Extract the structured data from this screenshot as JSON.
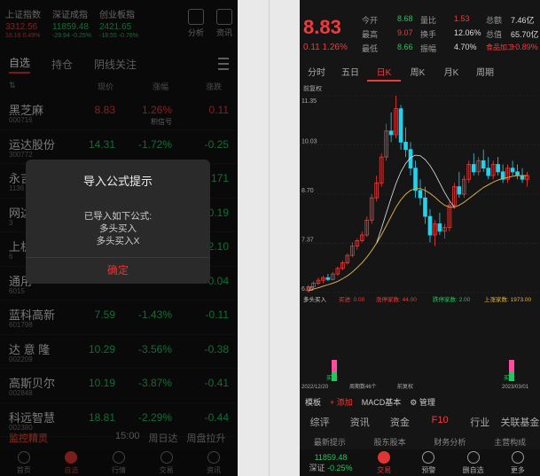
{
  "left": {
    "indices": [
      {
        "name": "上证指数",
        "value": "3312.56",
        "change": "16.16  0.49%",
        "color": "red"
      },
      {
        "name": "深证成指",
        "value": "11859.48",
        "change": "-29.94  -0.25%",
        "color": "green"
      },
      {
        "name": "创业板指",
        "value": "2421.65",
        "change": "-18.55  -0.76%",
        "color": "green"
      }
    ],
    "tools": {
      "analysis": "分析",
      "news": "资讯"
    },
    "tabs": [
      "自选",
      "持仓",
      "阴线关注"
    ],
    "columns": {
      "price": "现价",
      "pct": "涨幅",
      "chg": "涨跌"
    },
    "stocks": [
      {
        "name": "黑芝麻",
        "code": "000716",
        "price": "8.83",
        "pct": "1.26%",
        "chg": "0.11",
        "color": "red",
        "sub": "积信号"
      },
      {
        "name": "运达股份",
        "code": "300772",
        "price": "14.31",
        "pct": "-1.72%",
        "chg": "-0.25",
        "color": "green",
        "sub": ""
      },
      {
        "name": "永吉",
        "code": "1136",
        "price": "",
        "pct": "",
        "chg": "171",
        "color": "green",
        "sub": ""
      },
      {
        "name": "网达",
        "code": "3",
        "price": "",
        "pct": "",
        "chg": "0.19",
        "color": "green",
        "sub": ""
      },
      {
        "name": "上机",
        "code": "6",
        "price": "",
        "pct": "",
        "chg": "2.10",
        "color": "green",
        "sub": ""
      },
      {
        "name": "通用",
        "code": "6015",
        "price": "",
        "pct": "",
        "chg": "0.04",
        "color": "green",
        "sub": ""
      },
      {
        "name": "蓝科高新",
        "code": "601798",
        "price": "7.59",
        "pct": "-1.43%",
        "chg": "-0.11",
        "color": "green",
        "sub": ""
      },
      {
        "name": "达 意 隆",
        "code": "002209",
        "price": "10.29",
        "pct": "-3.56%",
        "chg": "-0.38",
        "color": "green",
        "sub": ""
      },
      {
        "name": "高斯贝尔",
        "code": "002848",
        "price": "10.19",
        "pct": "-3.87%",
        "chg": "-0.41",
        "color": "green",
        "sub": ""
      },
      {
        "name": "科远智慧",
        "code": "002380",
        "price": "18.81",
        "pct": "-2.29%",
        "chg": "-0.44",
        "color": "green",
        "sub": ""
      }
    ],
    "dialog": {
      "title": "导入公式提示",
      "lines": [
        "已导入如下公式:",
        "多头买入",
        "多头买入X"
      ],
      "confirm": "确定"
    },
    "bottom": {
      "brand": "监控精灵",
      "items": [
        "15:00",
        "周日达",
        "周盘拉升"
      ]
    },
    "nav": [
      "首页",
      "自选",
      "行情",
      "交易",
      "资讯"
    ]
  },
  "right": {
    "price": "8.83",
    "change": "0.11  1.26%",
    "quote": [
      {
        "a": "今开",
        "av": "8.68",
        "b": "量比",
        "bv": "1.53",
        "c": "总额",
        "cv": "7.46亿"
      },
      {
        "a": "最高",
        "av": "9.07",
        "b": "换手",
        "bv": "12.06%",
        "c": "总值",
        "cv": "65.70亿"
      },
      {
        "a": "最低",
        "av": "8.66",
        "b": "振幅",
        "bv": "4.70%",
        "c": "食品加工",
        "cv": "+0.89%"
      }
    ],
    "periods": [
      "分时",
      "五日",
      "日K",
      "周K",
      "月K",
      "周期"
    ],
    "chart_title": "前复权",
    "y_ticks": [
      "11.35",
      "10.03",
      "8.70",
      "7.37",
      "6.05"
    ],
    "indicator": {
      "name": "多头买入",
      "a": "买进: 0.00",
      "b": "涨停家数: 44.00",
      "c": "跌停家数: 2.00",
      "d": "上涨家数: 1973.00"
    },
    "dates": {
      "left": "2022/12/20",
      "mid": "周期数46个",
      "mid2": "前复权",
      "right": "2023/03/01"
    },
    "buy_label": "买进",
    "toolbar": {
      "template": "模板",
      "add": "添加",
      "macd": "MACD基本",
      "manage": "管理"
    },
    "ftabs": [
      "综评",
      "资讯",
      "资金",
      "F10",
      "行业",
      "关联基金"
    ],
    "subtabs": [
      "最新提示",
      "股东股本",
      "财务分析",
      "主营构成"
    ],
    "nav_index": {
      "value": "11859.48",
      "label": "深证",
      "pct": "-0.25%"
    },
    "nav": [
      "交易",
      "预警",
      "删自选",
      "更多"
    ]
  },
  "chart_data": {
    "type": "candlestick",
    "title": "",
    "ylim": [
      6.05,
      11.35
    ],
    "y_ticks": [
      11.35,
      10.03,
      8.7,
      7.37,
      6.05
    ],
    "x_range": [
      "2022/12/20",
      "2023/03/01"
    ],
    "candles": [
      [
        6.1,
        6.25,
        6.05,
        6.2
      ],
      [
        6.2,
        6.35,
        6.15,
        6.3
      ],
      [
        6.3,
        6.45,
        6.25,
        6.38
      ],
      [
        6.38,
        6.5,
        6.3,
        6.45
      ],
      [
        6.45,
        6.55,
        6.35,
        6.4
      ],
      [
        6.4,
        6.6,
        6.38,
        6.55
      ],
      [
        6.55,
        6.75,
        6.5,
        6.7
      ],
      [
        6.7,
        6.9,
        6.65,
        6.85
      ],
      [
        6.85,
        7.1,
        6.8,
        7.05
      ],
      [
        7.05,
        7.4,
        7.0,
        7.3
      ],
      [
        7.3,
        7.5,
        7.2,
        7.45
      ],
      [
        7.45,
        7.7,
        7.4,
        7.6
      ],
      [
        7.6,
        8.1,
        7.55,
        8.0
      ],
      [
        8.0,
        8.7,
        7.9,
        8.6
      ],
      [
        8.6,
        9.2,
        8.5,
        9.0
      ],
      [
        9.0,
        9.8,
        8.9,
        9.7
      ],
      [
        9.7,
        10.6,
        9.6,
        10.4
      ],
      [
        10.4,
        10.9,
        10.1,
        10.3
      ],
      [
        10.3,
        11.35,
        10.2,
        11.0
      ],
      [
        11.0,
        11.1,
        9.9,
        10.1
      ],
      [
        10.1,
        10.5,
        9.7,
        9.9
      ],
      [
        9.9,
        10.1,
        9.2,
        9.4
      ],
      [
        9.4,
        9.6,
        8.6,
        8.8
      ],
      [
        8.8,
        9.1,
        8.4,
        8.6
      ],
      [
        8.6,
        8.9,
        7.9,
        8.1
      ],
      [
        8.1,
        8.3,
        7.4,
        7.6
      ],
      [
        7.6,
        8.0,
        7.3,
        7.9
      ],
      [
        7.9,
        8.2,
        7.6,
        7.7
      ],
      [
        7.7,
        7.9,
        7.5,
        7.8
      ],
      [
        7.8,
        8.5,
        7.7,
        8.4
      ],
      [
        8.4,
        9.0,
        8.3,
        8.9
      ],
      [
        8.9,
        9.3,
        8.6,
        8.7
      ],
      [
        8.7,
        9.2,
        8.6,
        9.1
      ],
      [
        9.1,
        9.6,
        9.0,
        9.5
      ],
      [
        9.5,
        9.8,
        9.2,
        9.3
      ],
      [
        9.3,
        9.7,
        9.2,
        9.6
      ],
      [
        9.6,
        9.9,
        9.3,
        9.4
      ],
      [
        9.4,
        9.7,
        9.1,
        9.2
      ],
      [
        9.2,
        9.6,
        9.1,
        9.5
      ],
      [
        9.5,
        9.7,
        9.2,
        9.3
      ],
      [
        9.3,
        9.5,
        9.0,
        9.1
      ],
      [
        9.1,
        9.5,
        9.0,
        9.4
      ],
      [
        9.4,
        9.6,
        9.2,
        9.3
      ],
      [
        9.3,
        9.5,
        9.1,
        9.2
      ],
      [
        9.2,
        9.4,
        9.0,
        9.1
      ],
      [
        9.1,
        9.3,
        8.9,
        9.2
      ]
    ],
    "ma": [
      6.1,
      6.14,
      6.18,
      6.22,
      6.26,
      6.3,
      6.35,
      6.42,
      6.5,
      6.6,
      6.72,
      6.85,
      7.0,
      7.18,
      7.38,
      7.6,
      7.85,
      8.1,
      8.35,
      8.55,
      8.7,
      8.8,
      8.85,
      8.85,
      8.8,
      8.72,
      8.62,
      8.5,
      8.4,
      8.35,
      8.35,
      8.4,
      8.48,
      8.58,
      8.68,
      8.78,
      8.88,
      8.95,
      9.02,
      9.08,
      9.12,
      9.15,
      9.18,
      9.2,
      9.2,
      9.2
    ]
  }
}
